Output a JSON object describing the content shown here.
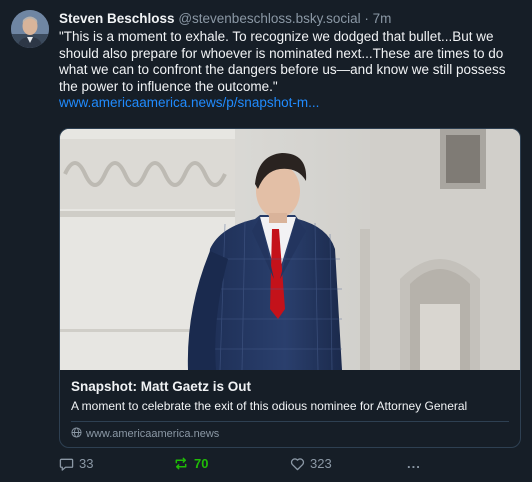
{
  "post": {
    "author_name": "Steven Beschloss",
    "author_handle": "@stevenbeschloss.bsky.social",
    "separator": "·",
    "timestamp": "7m",
    "text": "\"This is a moment to exhale. To recognize we dodged that bullet...But we should also prepare for whoever is nominated next...These are times to do what we can to confront the dangers before us—and know we still possess the power to influence the outcome.\"",
    "link_text": "www.americaamerica.news/p/snapshot-m..."
  },
  "card": {
    "title": "Snapshot: Matt Gaetz is Out",
    "description": "A moment to celebrate the exit of this odious nominee for Attorney General",
    "domain": "www.americaamerica.news"
  },
  "actions": {
    "replies": "33",
    "reposts": "70",
    "likes": "323",
    "more": "..."
  },
  "colors": {
    "background": "#161e27",
    "link": "#208bfe",
    "repost_active": "#20bc07",
    "muted": "#8b98a5",
    "border": "#2e4052"
  }
}
